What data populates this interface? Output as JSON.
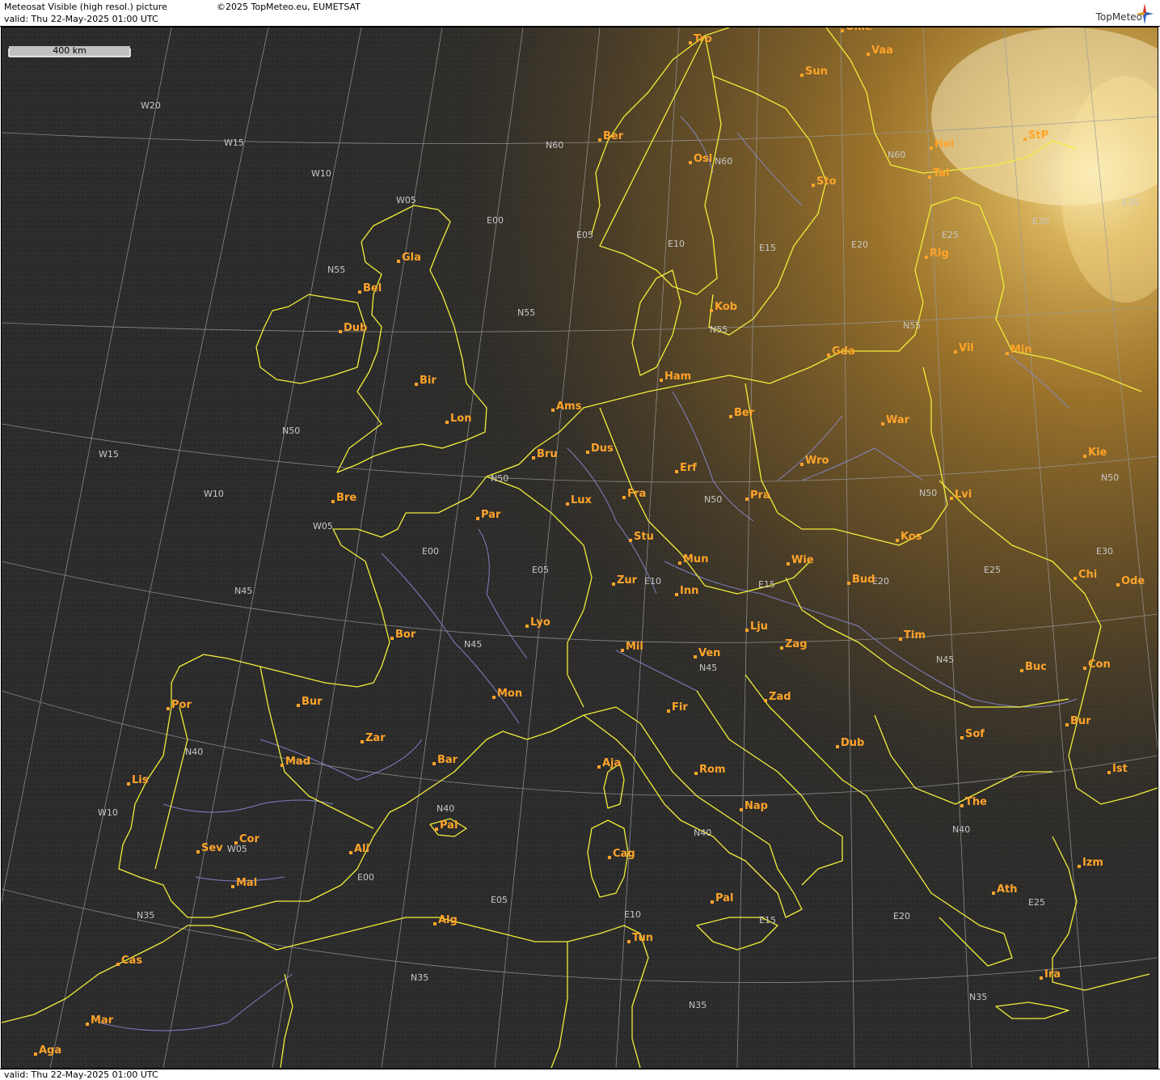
{
  "header": {
    "title": "Meteosat Visible (high resol.) picture",
    "copyright": "©2025 TopMeteo.eu, EUMETSAT",
    "valid": "valid:  Thu  22-May-2025  01:00 UTC",
    "logo_text": "TopMeteo"
  },
  "footer": {
    "valid": "valid:  Thu  22-May-2025  01:00 UTC"
  },
  "scale": {
    "label": "400 km"
  },
  "colors": {
    "map_background": "#2b2b2b",
    "border": "#f2ee3a",
    "river": "#8a8fe0",
    "grid": "#a8a8a8",
    "city": "#ffa42a",
    "dawn_glow": "#f0b030"
  },
  "cities": [
    {
      "name": "Tro"
    },
    {
      "name": "Ume"
    },
    {
      "name": "Vaa"
    },
    {
      "name": "Sun"
    },
    {
      "name": "Ber"
    },
    {
      "name": "Osl"
    },
    {
      "name": "Hel"
    },
    {
      "name": "StP"
    },
    {
      "name": "Sto"
    },
    {
      "name": "Tal"
    },
    {
      "name": "Gla"
    },
    {
      "name": "Rig"
    },
    {
      "name": "Bel"
    },
    {
      "name": "Kob"
    },
    {
      "name": "Dub"
    },
    {
      "name": "Vil"
    },
    {
      "name": "Gda"
    },
    {
      "name": "Min"
    },
    {
      "name": "Ham"
    },
    {
      "name": "Bir"
    },
    {
      "name": "Ams"
    },
    {
      "name": "Ber"
    },
    {
      "name": "Lon"
    },
    {
      "name": "War"
    },
    {
      "name": "Dus"
    },
    {
      "name": "Bru"
    },
    {
      "name": "Kie"
    },
    {
      "name": "Erf"
    },
    {
      "name": "Wro"
    },
    {
      "name": "Fra"
    },
    {
      "name": "Bre"
    },
    {
      "name": "Lux"
    },
    {
      "name": "Pra"
    },
    {
      "name": "Lvi"
    },
    {
      "name": "Par"
    },
    {
      "name": "Stu"
    },
    {
      "name": "Kos"
    },
    {
      "name": "Mun"
    },
    {
      "name": "Wie"
    },
    {
      "name": "Zur"
    },
    {
      "name": "Bud"
    },
    {
      "name": "Chi"
    },
    {
      "name": "Inn"
    },
    {
      "name": "Ode"
    },
    {
      "name": "Lyo"
    },
    {
      "name": "Lju"
    },
    {
      "name": "Bor"
    },
    {
      "name": "Tim"
    },
    {
      "name": "Mil"
    },
    {
      "name": "Ven"
    },
    {
      "name": "Zag"
    },
    {
      "name": "Buc"
    },
    {
      "name": "Con"
    },
    {
      "name": "Zad"
    },
    {
      "name": "Mon"
    },
    {
      "name": "Bur"
    },
    {
      "name": "Fir"
    },
    {
      "name": "Por"
    },
    {
      "name": "Zar"
    },
    {
      "name": "Dub"
    },
    {
      "name": "Sof"
    },
    {
      "name": "Bur"
    },
    {
      "name": "Aja"
    },
    {
      "name": "Bar"
    },
    {
      "name": "Mad"
    },
    {
      "name": "Rom"
    },
    {
      "name": "Ist"
    },
    {
      "name": "Lis"
    },
    {
      "name": "Nap"
    },
    {
      "name": "The"
    },
    {
      "name": "Pal"
    },
    {
      "name": "Cor"
    },
    {
      "name": "Sev"
    },
    {
      "name": "Ali"
    },
    {
      "name": "Cag"
    },
    {
      "name": "Izm"
    },
    {
      "name": "Mal"
    },
    {
      "name": "Pal"
    },
    {
      "name": "Ath"
    },
    {
      "name": "Alg"
    },
    {
      "name": "Tun"
    },
    {
      "name": "Cas"
    },
    {
      "name": "Ira"
    },
    {
      "name": "Mar"
    },
    {
      "name": "Aga"
    }
  ],
  "grid_labels": [
    "W20",
    "W15",
    "W10",
    "W05",
    "E00",
    "E05",
    "E10",
    "E15",
    "E20",
    "E25",
    "E30",
    "E35",
    "N60",
    "N60",
    "N60",
    "N55",
    "N55",
    "N55",
    "N55",
    "N50",
    "N50",
    "N50",
    "N50",
    "N50",
    "W15",
    "W10",
    "W05",
    "E00",
    "E05",
    "E10",
    "E15",
    "E20",
    "E25",
    "E30",
    "N45",
    "N45",
    "N45",
    "N45",
    "N40",
    "N40",
    "N40",
    "N40",
    "W10",
    "W05",
    "E00",
    "E05",
    "E10",
    "E15",
    "E20",
    "E25",
    "N35",
    "N35",
    "N35",
    "N35"
  ]
}
